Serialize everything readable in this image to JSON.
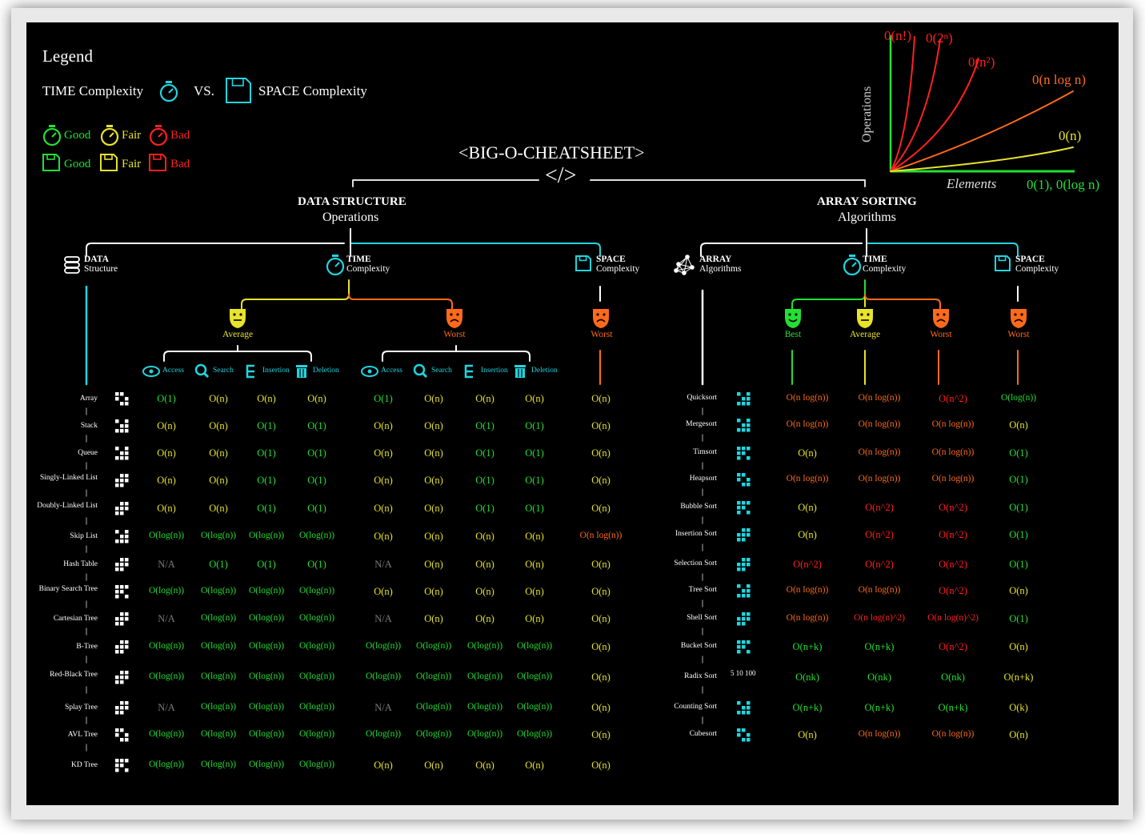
{
  "title": "<BIG-O-CHEATSHEET>",
  "title_tag": "</>",
  "legend": {
    "heading": "Legend",
    "time_label": "TIME Complexity",
    "vs": "VS.",
    "space_label": "SPACE Complexity",
    "good": "Good",
    "fair": "Fair",
    "bad": "Bad",
    "colors": {
      "good": "#22e033",
      "fair": "#e8e32b",
      "bad": "#ff2020",
      "orange": "#ff6a1a",
      "cyan": "#1fd6e0"
    }
  },
  "graph": {
    "ylabel": "Operations",
    "xlabel": "Elements",
    "curves": [
      "0(n!)",
      "0(2ⁿ)",
      "0(n²)",
      "0(n log n)",
      "0(n)",
      "0(1), 0(log n)"
    ]
  },
  "data_structure": {
    "heading": "DATA STRUCTURE",
    "subheading": "Operations",
    "col_ds_bold": "DATA",
    "col_ds": "Structure",
    "col_time_bold": "TIME",
    "col_time": "Complexity",
    "col_space_bold": "SPACE",
    "col_space": "Complexity",
    "average": "Average",
    "worst": "Worst",
    "space_worst": "Worst",
    "ops": [
      "Access",
      "Search",
      "Insertion",
      "Deletion"
    ],
    "rows": [
      {
        "name": "Array",
        "icon": "grid-icon",
        "avg": [
          "O(1)",
          "O(n)",
          "O(n)",
          "O(n)"
        ],
        "avgc": [
          "g",
          "y",
          "y",
          "y"
        ],
        "worst": [
          "O(1)",
          "O(n)",
          "O(n)",
          "O(n)"
        ],
        "worstc": [
          "g",
          "y",
          "y",
          "y"
        ],
        "space": "O(n)",
        "spacec": "y"
      },
      {
        "name": "Stack",
        "icon": "stack-icon",
        "avg": [
          "O(n)",
          "O(n)",
          "O(1)",
          "O(1)"
        ],
        "avgc": [
          "y",
          "y",
          "g",
          "g"
        ],
        "worst": [
          "O(n)",
          "O(n)",
          "O(1)",
          "O(1)"
        ],
        "worstc": [
          "y",
          "y",
          "g",
          "g"
        ],
        "space": "O(n)",
        "spacec": "y"
      },
      {
        "name": "Queue",
        "icon": "queue-icon",
        "avg": [
          "O(n)",
          "O(n)",
          "O(1)",
          "O(1)"
        ],
        "avgc": [
          "y",
          "y",
          "g",
          "g"
        ],
        "worst": [
          "O(n)",
          "O(n)",
          "O(1)",
          "O(1)"
        ],
        "worstc": [
          "y",
          "y",
          "g",
          "g"
        ],
        "space": "O(n)",
        "spacec": "y"
      },
      {
        "name": "Singly-Linked List",
        "icon": "singly-linked-list-icon",
        "avg": [
          "O(n)",
          "O(n)",
          "O(1)",
          "O(1)"
        ],
        "avgc": [
          "y",
          "y",
          "g",
          "g"
        ],
        "worst": [
          "O(n)",
          "O(n)",
          "O(1)",
          "O(1)"
        ],
        "worstc": [
          "y",
          "y",
          "g",
          "g"
        ],
        "space": "O(n)",
        "spacec": "y"
      },
      {
        "name": "Doubly-Linked List",
        "icon": "doubly-linked-list-icon",
        "avg": [
          "O(n)",
          "O(n)",
          "O(1)",
          "O(1)"
        ],
        "avgc": [
          "y",
          "y",
          "g",
          "g"
        ],
        "worst": [
          "O(n)",
          "O(n)",
          "O(1)",
          "O(1)"
        ],
        "worstc": [
          "y",
          "y",
          "g",
          "g"
        ],
        "space": "O(n)",
        "spacec": "y"
      },
      {
        "name": "Skip List",
        "icon": "skip-list-icon",
        "avg": [
          "O(log(n))",
          "O(log(n))",
          "O(log(n))",
          "O(log(n))"
        ],
        "avgc": [
          "g",
          "g",
          "g",
          "g"
        ],
        "worst": [
          "O(n)",
          "O(n)",
          "O(n)",
          "O(n)"
        ],
        "worstc": [
          "y",
          "y",
          "y",
          "y"
        ],
        "space": "O(n log(n))",
        "spacec": "o"
      },
      {
        "name": "Hash Table",
        "icon": "hash-table-icon",
        "avg": [
          "N/A",
          "O(1)",
          "O(1)",
          "O(1)"
        ],
        "avgc": [
          "n",
          "g",
          "g",
          "g"
        ],
        "worst": [
          "N/A",
          "O(n)",
          "O(n)",
          "O(n)"
        ],
        "worstc": [
          "n",
          "y",
          "y",
          "y"
        ],
        "space": "O(n)",
        "spacec": "y"
      },
      {
        "name": "Binary Search Tree",
        "icon": "binary-tree-icon",
        "avg": [
          "O(log(n))",
          "O(log(n))",
          "O(log(n))",
          "O(log(n))"
        ],
        "avgc": [
          "g",
          "g",
          "g",
          "g"
        ],
        "worst": [
          "O(n)",
          "O(n)",
          "O(n)",
          "O(n)"
        ],
        "worstc": [
          "y",
          "y",
          "y",
          "y"
        ],
        "space": "O(n)",
        "spacec": "y"
      },
      {
        "name": "Cartesian Tree",
        "icon": "cartesian-tree-icon",
        "avg": [
          "N/A",
          "O(log(n))",
          "O(log(n))",
          "O(log(n))"
        ],
        "avgc": [
          "n",
          "g",
          "g",
          "g"
        ],
        "worst": [
          "N/A",
          "O(n)",
          "O(n)",
          "O(n)"
        ],
        "worstc": [
          "n",
          "y",
          "y",
          "y"
        ],
        "space": "O(n)",
        "spacec": "y"
      },
      {
        "name": "B-Tree",
        "icon": "b-tree-icon",
        "avg": [
          "O(log(n))",
          "O(log(n))",
          "O(log(n))",
          "O(log(n))"
        ],
        "avgc": [
          "g",
          "g",
          "g",
          "g"
        ],
        "worst": [
          "O(log(n))",
          "O(log(n))",
          "O(log(n))",
          "O(log(n))"
        ],
        "worstc": [
          "g",
          "g",
          "g",
          "g"
        ],
        "space": "O(n)",
        "spacec": "y"
      },
      {
        "name": "Red-Black Tree",
        "icon": "red-black-tree-icon",
        "avg": [
          "O(log(n))",
          "O(log(n))",
          "O(log(n))",
          "O(log(n))"
        ],
        "avgc": [
          "g",
          "g",
          "g",
          "g"
        ],
        "worst": [
          "O(log(n))",
          "O(log(n))",
          "O(log(n))",
          "O(log(n))"
        ],
        "worstc": [
          "g",
          "g",
          "g",
          "g"
        ],
        "space": "O(n)",
        "spacec": "y"
      },
      {
        "name": "Splay Tree",
        "icon": "splay-tree-icon",
        "avg": [
          "N/A",
          "O(log(n))",
          "O(log(n))",
          "O(log(n))"
        ],
        "avgc": [
          "n",
          "g",
          "g",
          "g"
        ],
        "worst": [
          "N/A",
          "O(log(n))",
          "O(log(n))",
          "O(log(n))"
        ],
        "worstc": [
          "n",
          "g",
          "g",
          "g"
        ],
        "space": "O(n)",
        "spacec": "y"
      },
      {
        "name": "AVL Tree",
        "icon": "avl-tree-icon",
        "avg": [
          "O(log(n))",
          "O(log(n))",
          "O(log(n))",
          "O(log(n))"
        ],
        "avgc": [
          "g",
          "g",
          "g",
          "g"
        ],
        "worst": [
          "O(log(n))",
          "O(log(n))",
          "O(log(n))",
          "O(log(n))"
        ],
        "worstc": [
          "g",
          "g",
          "g",
          "g"
        ],
        "space": "O(n)",
        "spacec": "y"
      },
      {
        "name": "KD Tree",
        "icon": "kd-tree-icon",
        "avg": [
          "O(log(n))",
          "O(log(n))",
          "O(log(n))",
          "O(log(n))"
        ],
        "avgc": [
          "g",
          "g",
          "g",
          "g"
        ],
        "worst": [
          "O(n)",
          "O(n)",
          "O(n)",
          "O(n)"
        ],
        "worstc": [
          "y",
          "y",
          "y",
          "y"
        ],
        "space": "O(n)",
        "spacec": "y"
      }
    ]
  },
  "array_sorting": {
    "heading": "ARRAY SORTING",
    "subheading": "Algorithms",
    "col_arr_bold": "ARRAY",
    "col_arr": "Algorithms",
    "col_time_bold": "TIME",
    "col_time": "Complexity",
    "col_space_bold": "SPACE",
    "col_space": "Complexity",
    "best": "Best",
    "average": "Average",
    "worst": "Worst",
    "space_worst": "Worst",
    "rows": [
      {
        "name": "Quicksort",
        "icon": "quicksort-icon",
        "vals": [
          "O(n log(n))",
          "O(n log(n))",
          "O(n^2)",
          "O(log(n))"
        ],
        "cols": [
          "o",
          "o",
          "r",
          "g"
        ]
      },
      {
        "name": "Mergesort",
        "icon": "mergesort-icon",
        "vals": [
          "O(n log(n))",
          "O(n log(n))",
          "O(n log(n))",
          "O(n)"
        ],
        "cols": [
          "o",
          "o",
          "o",
          "y"
        ]
      },
      {
        "name": "Timsort",
        "icon": "timsort-icon",
        "vals": [
          "O(n)",
          "O(n log(n))",
          "O(n log(n))",
          "O(1)"
        ],
        "cols": [
          "y",
          "o",
          "o",
          "g"
        ]
      },
      {
        "name": "Heapsort",
        "icon": "heapsort-icon",
        "vals": [
          "O(n log(n))",
          "O(n log(n))",
          "O(n log(n))",
          "O(1)"
        ],
        "cols": [
          "o",
          "o",
          "o",
          "g"
        ]
      },
      {
        "name": "Bubble Sort",
        "icon": "bubble-sort-icon",
        "vals": [
          "O(n)",
          "O(n^2)",
          "O(n^2)",
          "O(1)"
        ],
        "cols": [
          "y",
          "r",
          "r",
          "g"
        ]
      },
      {
        "name": "Insertion Sort",
        "icon": "insertion-sort-icon",
        "vals": [
          "O(n)",
          "O(n^2)",
          "O(n^2)",
          "O(1)"
        ],
        "cols": [
          "y",
          "r",
          "r",
          "g"
        ]
      },
      {
        "name": "Selection Sort",
        "icon": "selection-sort-icon",
        "vals": [
          "O(n^2)",
          "O(n^2)",
          "O(n^2)",
          "O(1)"
        ],
        "cols": [
          "r",
          "r",
          "r",
          "g"
        ]
      },
      {
        "name": "Tree Sort",
        "icon": "tree-sort-icon",
        "vals": [
          "O(n log(n))",
          "O(n log(n))",
          "O(n^2)",
          "O(n)"
        ],
        "cols": [
          "o",
          "o",
          "r",
          "y"
        ]
      },
      {
        "name": "Shell Sort",
        "icon": "shell-sort-icon",
        "vals": [
          "O(n log(n))",
          "O(n log(n)^2)",
          "O(n log(n)^2)",
          "O(1)"
        ],
        "cols": [
          "o",
          "r",
          "r",
          "g"
        ]
      },
      {
        "name": "Bucket Sort",
        "icon": "bucket-sort-icon",
        "vals": [
          "O(n+k)",
          "O(n+k)",
          "O(n^2)",
          "O(n)"
        ],
        "cols": [
          "g",
          "g",
          "r",
          "y"
        ]
      },
      {
        "name": "Radix Sort",
        "icon": "radix-sort-icon",
        "vals": [
          "O(nk)",
          "O(nk)",
          "O(nk)",
          "O(n+k)"
        ],
        "cols": [
          "g",
          "g",
          "g",
          "y"
        ]
      },
      {
        "name": "Counting Sort",
        "icon": "counting-sort-icon",
        "vals": [
          "O(n+k)",
          "O(n+k)",
          "O(n+k)",
          "O(k)"
        ],
        "cols": [
          "g",
          "g",
          "g",
          "y"
        ]
      },
      {
        "name": "Cubesort",
        "icon": "cubesort-icon",
        "vals": [
          "O(n)",
          "O(n log(n))",
          "O(n log(n))",
          "O(n)"
        ],
        "cols": [
          "y",
          "o",
          "o",
          "y"
        ]
      }
    ],
    "radix_icon_text": "5 10 100"
  }
}
